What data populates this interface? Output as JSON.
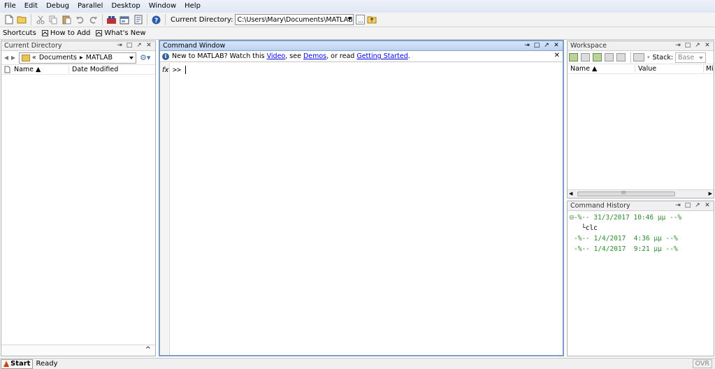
{
  "menu": [
    "File",
    "Edit",
    "Debug",
    "Parallel",
    "Desktop",
    "Window",
    "Help"
  ],
  "toolbar": {
    "current_directory_label": "Current Directory:",
    "current_directory_value": "C:\\Users\\Mary\\Documents\\MATLAB",
    "browse_label": "..."
  },
  "shortcuts": {
    "label": "Shortcuts",
    "how_to_add": "How to Add",
    "whats_new": "What's New"
  },
  "current_directory_panel": {
    "title": "Current Directory",
    "path": [
      "«",
      "Documents",
      "▸",
      "MATLAB"
    ],
    "col_name": "Name ▲",
    "col_modified": "Date Modified",
    "footer_symbol": "^"
  },
  "command_window": {
    "title": "Command Window",
    "banner_prefix": "New to MATLAB? Watch this ",
    "banner_video": "Video",
    "banner_mid1": ", see ",
    "banner_demos": "Demos",
    "banner_mid2": ", or read ",
    "banner_getting_started": "Getting Started",
    "banner_suffix": ".",
    "fx": "fx",
    "prompt": ">>"
  },
  "workspace": {
    "title": "Workspace",
    "stack_label": "Stack:",
    "stack_value": "Base",
    "col_name": "Name ▲",
    "col_value": "Value",
    "col_min": "Mi",
    "scroll_grip": "III"
  },
  "command_history": {
    "title": "Command History",
    "entries": [
      {
        "text": "⊟-%-- 31/3/2017 10:46 μμ --%"
      },
      {
        "text": "└clc"
      },
      {
        "text": "-%-- 1/4/2017  4:36 μμ --%"
      },
      {
        "text": "-%-- 1/4/2017  9:21 μμ --%"
      }
    ]
  },
  "status": {
    "start": "Start",
    "text": "Ready",
    "ovr": "OVR"
  },
  "colors": {
    "active_title": "#bcd3f1",
    "history_date": "#2e8b2e",
    "link": "#0000ee"
  }
}
